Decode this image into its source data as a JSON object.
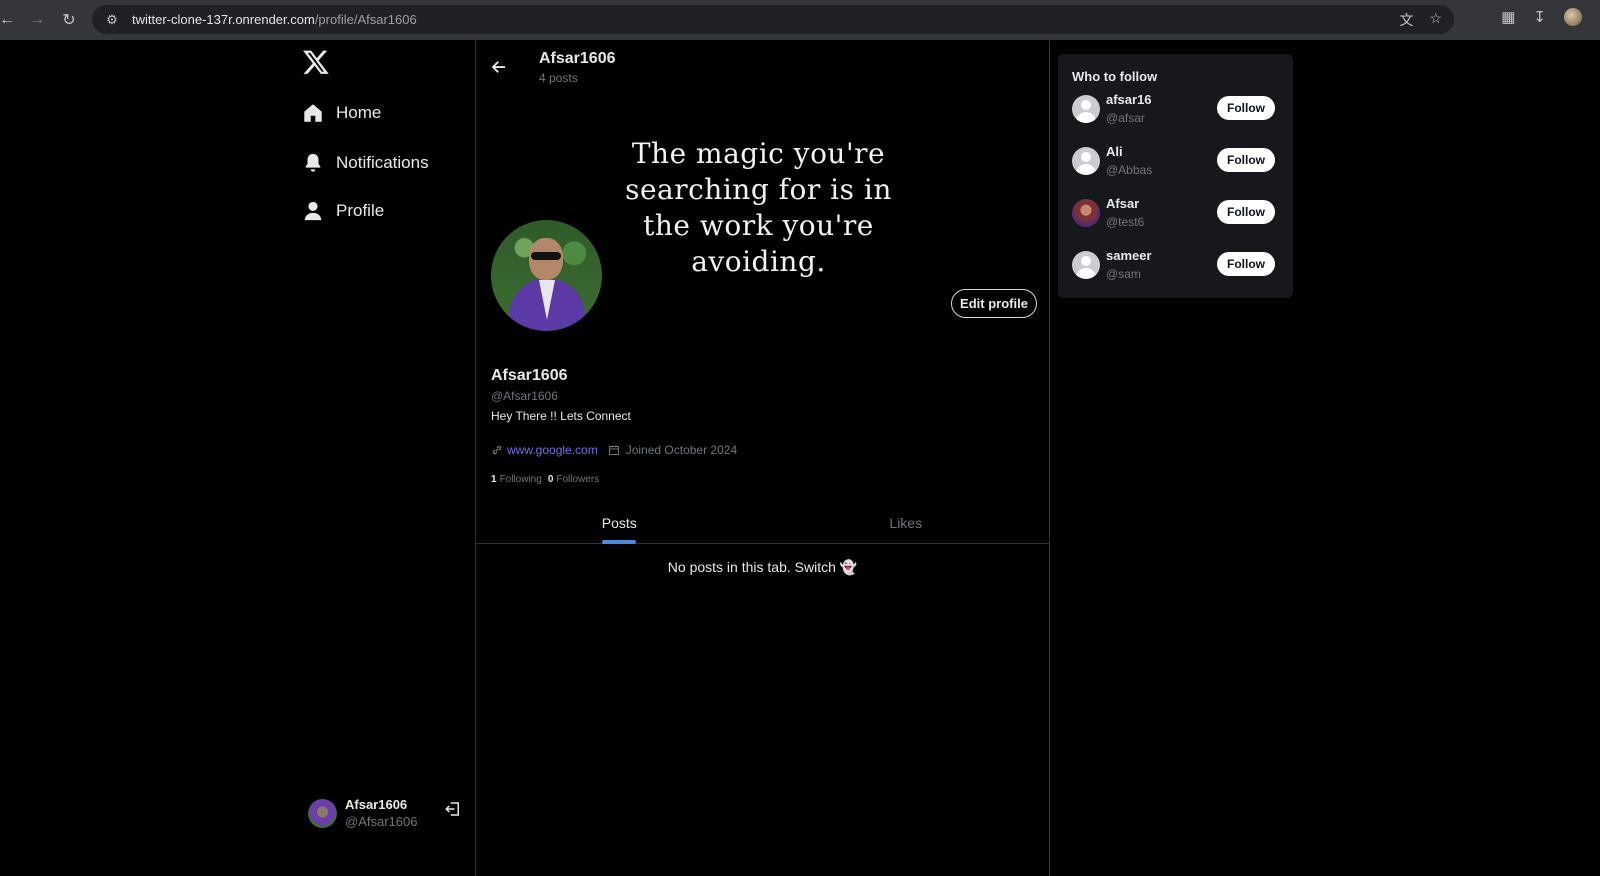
{
  "browser": {
    "url_host": "twitter-clone-137r.onrender.com",
    "url_path": "/profile/Afsar1606"
  },
  "sidebar": {
    "items": [
      {
        "label": "Home",
        "icon": "home-icon"
      },
      {
        "label": "Notifications",
        "icon": "bell-icon"
      },
      {
        "label": "Profile",
        "icon": "user-icon"
      }
    ],
    "account": {
      "name": "Afsar1606",
      "handle": "@Afsar1606"
    }
  },
  "header": {
    "name": "Afsar1606",
    "post_count": "4 posts"
  },
  "cover": {
    "quote": "The magic you're searching for is in the work you're avoiding."
  },
  "profile": {
    "edit_label": "Edit profile",
    "name": "Afsar1606",
    "handle": "@Afsar1606",
    "bio": "Hey There !! Lets Connect",
    "link": "www.google.com",
    "joined": "Joined October 2024",
    "following_count": "1",
    "following_label": "Following",
    "followers_count": "0",
    "followers_label": "Followers"
  },
  "tabs": [
    {
      "label": "Posts",
      "active": true
    },
    {
      "label": "Likes",
      "active": false
    }
  ],
  "empty_message": "No posts in this tab. Switch 👻",
  "who_to_follow": {
    "title": "Who to follow",
    "button_label": "Follow",
    "users": [
      {
        "name": "afsar16",
        "handle": "@afsar"
      },
      {
        "name": "Ali",
        "handle": "@Abbas"
      },
      {
        "name": "Afsar",
        "handle": "@test6"
      },
      {
        "name": "sameer",
        "handle": "@sam"
      }
    ]
  },
  "colors": {
    "accent": "#4a89dc",
    "link": "#7c6af0",
    "background": "#000000"
  }
}
